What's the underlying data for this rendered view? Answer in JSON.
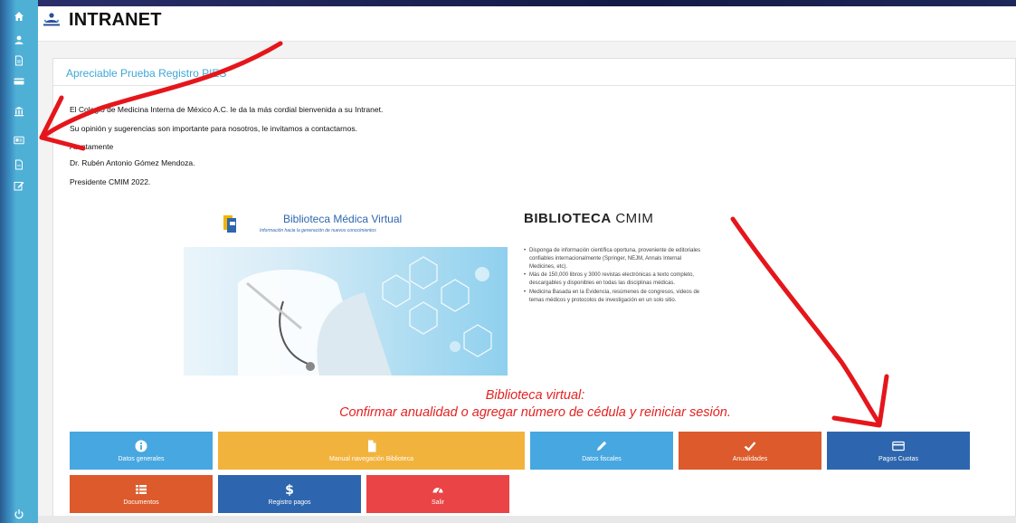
{
  "header": {
    "title": "INTRANET"
  },
  "sidebar": {
    "items": [
      {
        "icon": "home-icon"
      },
      {
        "icon": "user-icon"
      },
      {
        "icon": "document-icon"
      },
      {
        "icon": "credit-card-icon"
      },
      {
        "icon": "bank-icon"
      },
      {
        "icon": "id-card-icon"
      },
      {
        "icon": "file-icon"
      },
      {
        "icon": "edit-icon"
      }
    ],
    "logout_icon": "power-icon"
  },
  "content": {
    "greeting": "Apreciable Prueba Registro PIES",
    "paragraphs": [
      "El Colegio de Medicina Interna de México A.C. le da la más cordial bienvenida a su Intranet.",
      "Su opinión y sugerencias son importante para nosotros, le invitamos a contactarnos.",
      "Atentamente",
      "Dr. Rubén Antonio Gómez Mendoza.",
      "Presidente CMIM 2022."
    ],
    "banner": {
      "logo_title": "Biblioteca Médica Virtual",
      "logo_subtitle": "Información hacia la generación de nuevos conocimientos",
      "title_bold": "BIBLIOTECA",
      "title_light": "CMIM",
      "bullets": [
        "Disponga de información científica oportuna, proveniente de editoriales confiables internacionalmente (Springer, NEJM, Annals Internal Medicines, etc).",
        "Más de 150,000 libros y 3000 revistas electrónicas a texto completo, descargables y disponibles en todas las disciplinas médicas.",
        "Medicina Basada en la Evidencia, resúmenes de congresos, videos de temas médicos y protocolos de investigación en un solo sitio."
      ]
    },
    "notice_line1": "Biblioteca virtual:",
    "notice_line2": "Confirmar anualidad o agregar  número de cédula y reiniciar sesión."
  },
  "tiles": [
    {
      "label": "Datos generales",
      "icon": "info-icon",
      "color": "#47a7e0"
    },
    {
      "label": "Manual navegación Biblioteca",
      "icon": "document-icon",
      "color": "#f2b33d"
    },
    {
      "label": "Datos fiscales",
      "icon": "pencil-icon",
      "color": "#47a7e0"
    },
    {
      "label": "Anualidades",
      "icon": "check-icon",
      "color": "#dc5a2b"
    },
    {
      "label": "Pagos Cuotas",
      "icon": "credit-card-icon",
      "color": "#2d66ae"
    },
    {
      "label": "Documentos",
      "icon": "list-icon",
      "color": "#dc5a2b"
    },
    {
      "label": "Registro pagos",
      "icon": "dollar-icon",
      "color": "#2d66ae"
    },
    {
      "label": "Salir",
      "icon": "gauge-icon",
      "color": "#ea4446"
    }
  ]
}
